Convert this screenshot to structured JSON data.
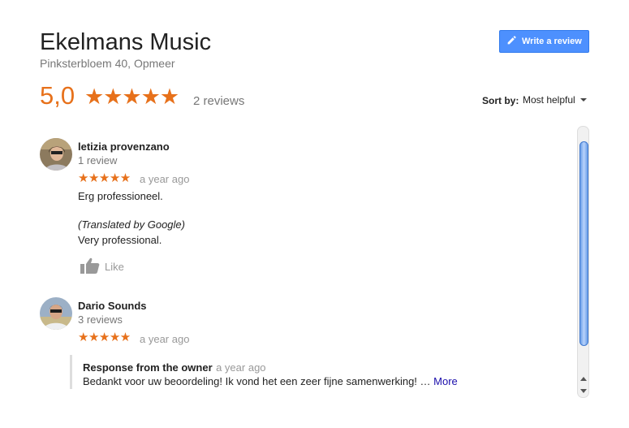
{
  "business": {
    "name": "Ekelmans Music",
    "address": "Pinksterbloem 40, Opmeer",
    "rating": "5,0",
    "stars": "★★★★★",
    "review_count": "2 reviews"
  },
  "actions": {
    "write_review": "Write a review"
  },
  "sort": {
    "label": "Sort by:",
    "value": "Most helpful"
  },
  "reviews": [
    {
      "author": "letizia provenzano",
      "author_reviews": "1 review",
      "stars": "★★★★★",
      "when": "a year ago",
      "text": "Erg professioneel.",
      "translated_note": "(Translated by Google)",
      "translation": "Very professional.",
      "like_label": "Like"
    },
    {
      "author": "Dario Sounds",
      "author_reviews": "3 reviews",
      "stars": "★★★★★",
      "when": "a year ago",
      "owner_response": {
        "title": "Response from the owner",
        "when": "a year ago",
        "text": "Bedankt voor uw beoordeling! Ik vond het een zeer fijne samenwerking! …",
        "more": "More"
      }
    }
  ],
  "colors": {
    "accent": "#e7711b",
    "button": "#4d90fe",
    "link": "#1a0dab"
  },
  "icons": [
    "pencil-icon",
    "star-icon",
    "thumbs-up-icon",
    "caret-down-icon"
  ]
}
